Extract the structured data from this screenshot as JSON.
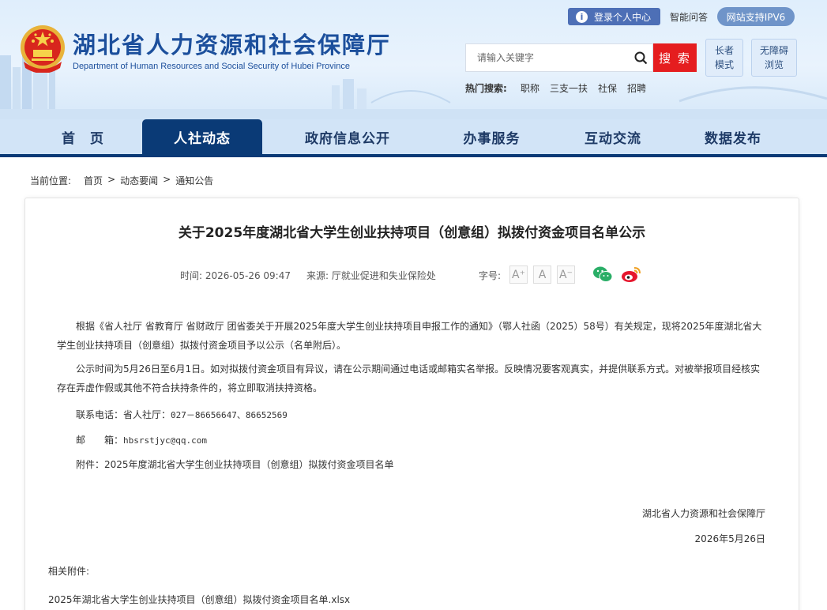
{
  "header": {
    "site_title": "湖北省人力资源和社会保障厅",
    "site_subtitle": "Department of Human Resources and Social Security of Hubei Province",
    "login_label": "登录个人中心",
    "smart_qa": "智能问答",
    "ipv6_label": "网站支持IPV6",
    "search_placeholder": "请输入关键字",
    "search_button": "搜 索",
    "elder_mode": [
      "长者",
      "模式"
    ],
    "barrier_free": [
      "无障碍",
      "浏览"
    ],
    "hot_search_label": "热门搜索:",
    "hot_search_items": [
      "职称",
      "三支一扶",
      "社保",
      "招聘"
    ]
  },
  "nav": {
    "items": [
      "首　页",
      "人社动态",
      "政府信息公开",
      "办事服务",
      "互动交流",
      "数据发布"
    ],
    "active_index": 1
  },
  "breadcrumb": {
    "label": "当前位置:",
    "items": [
      "首页",
      "动态要闻",
      "通知公告"
    ],
    "separator": ">"
  },
  "article": {
    "title": "关于2025年度湖北省大学生创业扶持项目（创意组）拟拨付资金项目名单公示",
    "time": "时间: 2026-05-26 09:47",
    "source": "来源:  厅就业促进和失业保险处",
    "font_size_label": "字号:",
    "font_size_buttons": [
      "A⁺",
      "A",
      "A⁻"
    ],
    "paragraph1": "根据《省人社厅 省教育厅 省财政厅 团省委关于开展2025年度大学生创业扶持项目申报工作的通知》（鄂人社函（2025）58号）有关规定，现将2025年度湖北省大学生创业扶持项目（创意组）拟拨付资金项目予以公示（名单附后）。",
    "paragraph2": "公示时间为5月26日至6月1日。如对拟拨付资金项目有异议，请在公示期间通过电话或邮箱实名举报。反映情况要客观真实，并提供联系方式。对被举报项目经核实存在弄虚作假或其他不符合扶持条件的，将立即取消扶持资格。",
    "phone_label": "联系电话：省人社厅：",
    "phone_value": "027－86656647、86652569",
    "email_label": "邮　　箱：",
    "email_value": "hbsrstjyc@qq.com",
    "attachment_line": "附件：2025年度湖北省大学生创业扶持项目（创意组）拟拨付资金项目名单",
    "signature": "湖北省人力资源和社会保障厅",
    "sign_date": "2026年5月26日",
    "related_label": "相关附件:",
    "attachment_file": "2025年湖北省大学生创业扶持项目（创意组）拟拨付资金项目名单.xlsx"
  },
  "colors": {
    "brand_blue": "#0a3a76",
    "search_red": "#e51d1f",
    "wechat_green": "#2aae67",
    "weibo_orange": "#f0a022"
  }
}
